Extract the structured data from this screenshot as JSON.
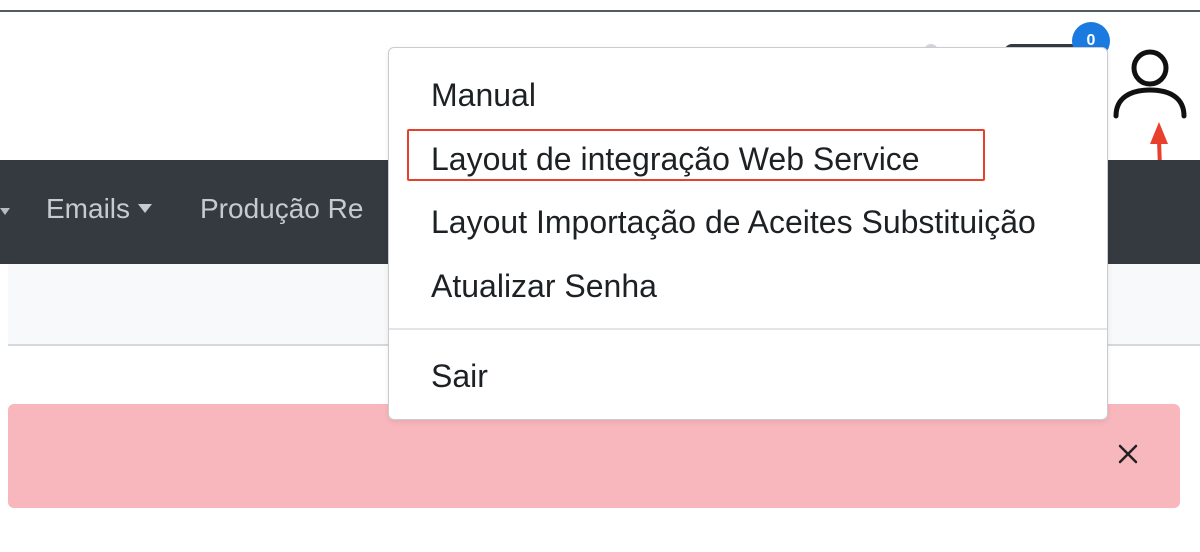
{
  "header": {
    "notification_count": "0",
    "badge_color": "#1a7ae0"
  },
  "navbar": {
    "background": "#343a40",
    "items": [
      {
        "label": "Emails"
      },
      {
        "label": "Produção Re"
      }
    ]
  },
  "user_menu": {
    "items": [
      {
        "label": "Manual"
      },
      {
        "label": "Layout de integração Web Service",
        "highlighted": true
      },
      {
        "label": "Layout Importação de Aceites Substituição"
      },
      {
        "label": "Atualizar Senha"
      },
      {
        "label": "Sair"
      }
    ],
    "highlight_color": "#e8402c"
  },
  "alert": {
    "background": "#f8b7bc",
    "close_icon": "close-icon"
  },
  "annotations": {
    "arrow_color": "#e8402c",
    "arrow_icon": "arrow-up-icon"
  }
}
